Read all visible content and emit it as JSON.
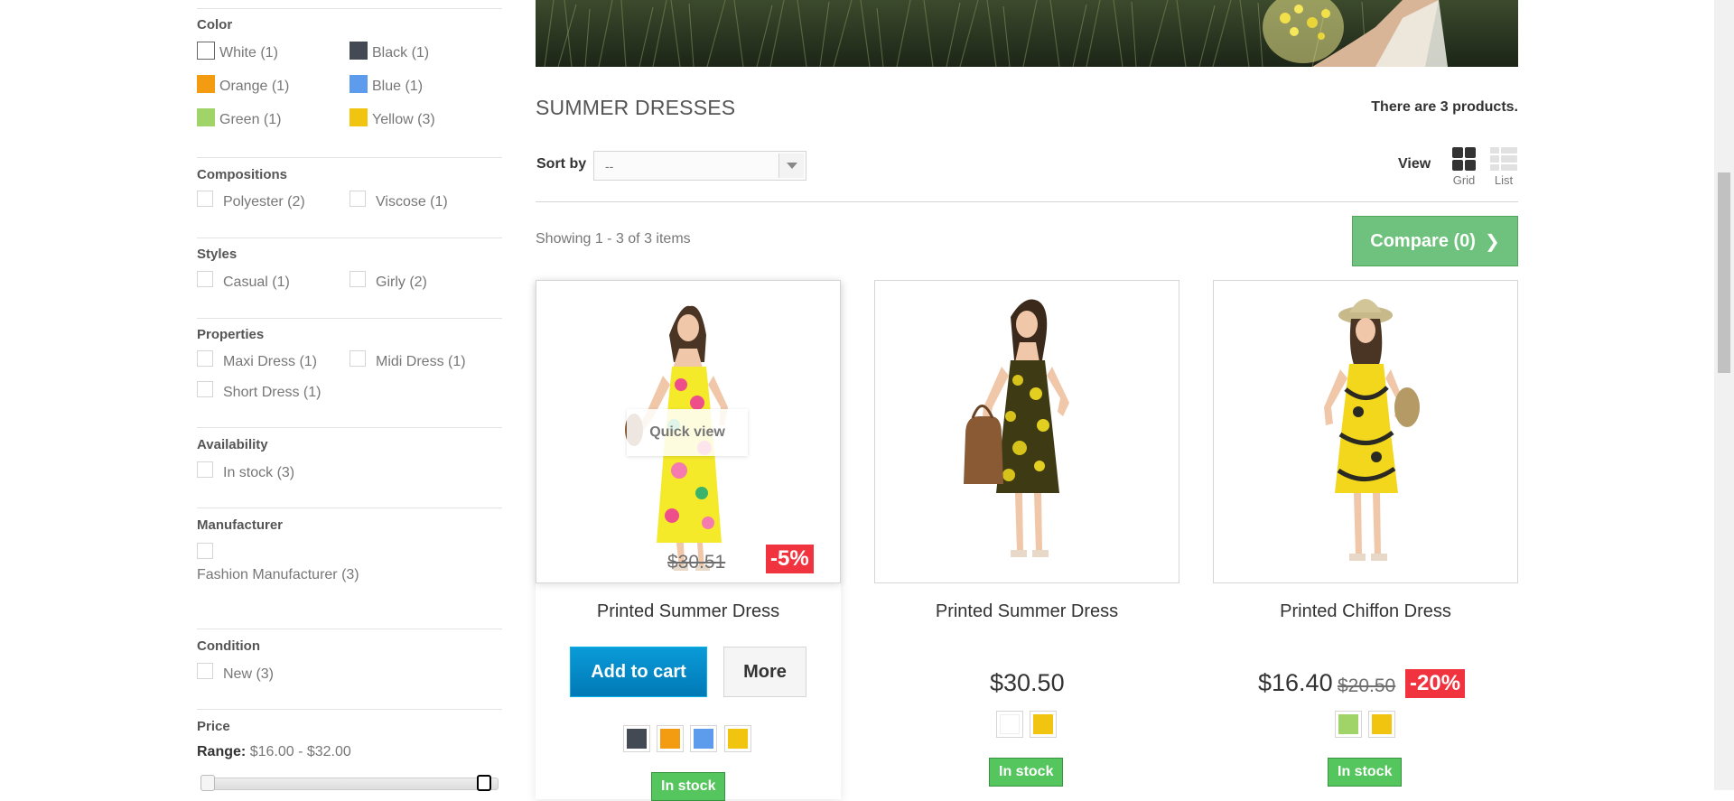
{
  "sidebar": {
    "color": {
      "title": "Color",
      "items": [
        {
          "label": "White (1)",
          "swatch": "#ffffff"
        },
        {
          "label": "Black (1)",
          "swatch": "#434a54"
        },
        {
          "label": "Orange (1)",
          "swatch": "#f39c11"
        },
        {
          "label": "Blue (1)",
          "swatch": "#5d9cec"
        },
        {
          "label": "Green (1)",
          "swatch": "#a0d468"
        },
        {
          "label": "Yellow (3)",
          "swatch": "#f1c40f"
        }
      ]
    },
    "compositions": {
      "title": "Compositions",
      "items": [
        "Polyester (2)",
        "Viscose (1)"
      ]
    },
    "styles": {
      "title": "Styles",
      "items": [
        "Casual (1)",
        "Girly (2)"
      ]
    },
    "properties": {
      "title": "Properties",
      "items": [
        "Maxi Dress (1)",
        "Midi Dress (1)",
        "Short Dress (1)"
      ]
    },
    "availability": {
      "title": "Availability",
      "items": [
        "In stock (3)"
      ]
    },
    "manufacturer": {
      "title": "Manufacturer",
      "items": [
        "Fashion Manufacturer (3)"
      ]
    },
    "condition": {
      "title": "Condition",
      "items": [
        "New (3)"
      ]
    },
    "price": {
      "title": "Price",
      "range_label": "Range:",
      "range_value": "$16.00 - $32.00"
    }
  },
  "main": {
    "category_title": "SUMMER DRESSES",
    "product_count": "There are 3 products.",
    "sort_label": "Sort by",
    "sort_value": "--",
    "view_label": "View",
    "view_grid": "Grid",
    "view_list": "List",
    "showing": "Showing 1 - 3 of 3 items",
    "compare": "Compare (0)"
  },
  "products": [
    {
      "name": "Printed Summer Dress",
      "old_price": "$30.51",
      "discount": "-5%",
      "quick_view": "Quick view",
      "add_to_cart": "Add to cart",
      "more": "More",
      "colors": [
        "#434a54",
        "#f39c11",
        "#5d9cec",
        "#f1c40f"
      ],
      "stock": "In stock"
    },
    {
      "name": "Printed Summer Dress",
      "price": "$30.50",
      "colors": [
        "#ffffff",
        "#f1c40f"
      ],
      "stock": "In stock"
    },
    {
      "name": "Printed Chiffon Dress",
      "price": "$16.40",
      "old_price": "$20.50",
      "discount": "-20%",
      "colors": [
        "#a0d468",
        "#f1c40f"
      ],
      "stock": "In stock"
    }
  ],
  "icons": {
    "sort_arrow": "chevron-down-icon",
    "grid": "grid-view-icon",
    "list": "list-view-icon",
    "compare": "chevron-right-icon"
  }
}
